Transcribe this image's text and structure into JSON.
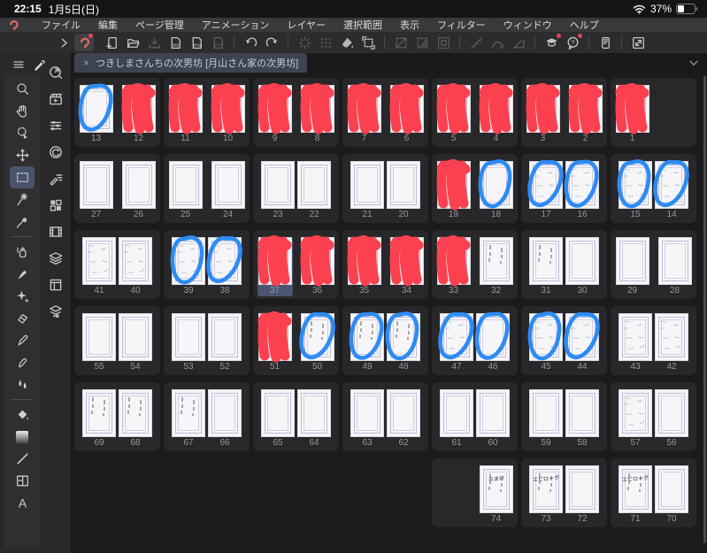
{
  "status_bar": {
    "time": "22:15",
    "date": "1月5日(日)",
    "battery_percent": "37%",
    "icons": [
      "wifi-icon",
      "battery-icon"
    ]
  },
  "menu_bar": {
    "logo_icon": "clip-studio-logo-icon",
    "items": [
      "ファイル",
      "編集",
      "ページ管理",
      "アニメーション",
      "レイヤー",
      "選択範囲",
      "表示",
      "フィルター",
      "ウィンドウ",
      "ヘルプ"
    ]
  },
  "toolbar": {
    "items": [
      {
        "icon": "collapse-chevron-icon"
      },
      {
        "icon": "app-logo-icon",
        "boxed": true,
        "badge": true
      },
      {
        "icon": "new-page-icon"
      },
      {
        "icon": "folder-open-icon"
      },
      {
        "icon": "export-down-icon",
        "dim": true
      },
      {
        "icon": "file-jpg-icon",
        "label": "jpg"
      },
      {
        "icon": "file-png-icon",
        "label": "png"
      },
      {
        "icon": "file-psd-icon",
        "label": "psd",
        "dim": true
      },
      {
        "divider": true
      },
      {
        "icon": "undo-icon"
      },
      {
        "icon": "redo-icon"
      },
      {
        "divider": true
      },
      {
        "icon": "processing-icon",
        "dim": true
      },
      {
        "icon": "screentone-icon",
        "dim": true
      },
      {
        "icon": "material-bucket-icon"
      },
      {
        "icon": "canvas-crop-icon"
      },
      {
        "divider": true
      },
      {
        "icon": "deselect-icon",
        "dim": true
      },
      {
        "icon": "invert-selection-icon",
        "dim": true
      },
      {
        "icon": "selection-border-icon",
        "dim": true
      },
      {
        "divider": true
      },
      {
        "icon": "snap-ruler-icon",
        "dim": true
      },
      {
        "icon": "snap-curve-icon",
        "dim": true
      },
      {
        "icon": "snap-angle-icon",
        "dim": true
      },
      {
        "divider": true
      },
      {
        "icon": "tutorial-cap-icon",
        "badge": true
      },
      {
        "icon": "help-bubble-icon",
        "badge": true
      },
      {
        "divider": true
      },
      {
        "icon": "companion-device-icon"
      },
      {
        "divider": true
      },
      {
        "icon": "window-resize-icon"
      }
    ]
  },
  "tab_bar": {
    "close_glyph": "×",
    "title": "つきしまさんちの次男坊 [月山さん家の次男坊]",
    "chevron_icon": "tab-list-chevron-down-icon"
  },
  "sidebar": {
    "header_icons": [
      "palette-menu-icon",
      "edit-pen-icon"
    ],
    "tools": [
      {
        "icon": "zoom-icon"
      },
      {
        "icon": "hand-icon"
      },
      {
        "icon": "operate-icon"
      },
      {
        "icon": "move-icon"
      },
      {
        "icon": "select-rect-icon",
        "selected": true
      },
      {
        "icon": "wand-icon"
      },
      {
        "icon": "eyedropper-icon"
      },
      {
        "divider": true
      },
      {
        "icon": "airbrush-icon"
      },
      {
        "icon": "pen-icon"
      },
      {
        "icon": "decoration-icon"
      },
      {
        "icon": "eraser-icon"
      },
      {
        "icon": "marker-icon"
      },
      {
        "icon": "blend-icon"
      },
      {
        "icon": "water-icon"
      },
      {
        "divider": true
      },
      {
        "icon": "fill-bucket-icon"
      },
      {
        "icon": "gradient-icon"
      },
      {
        "icon": "line-icon"
      },
      {
        "icon": "frame-border-icon"
      },
      {
        "icon": "text-icon"
      }
    ],
    "panel_icons": [
      "quick-access-icon",
      "clapper-icon",
      "correction-icon",
      "timeline-icon",
      "story-editor-icon",
      "material-grid-icon",
      "filmstrip-icon",
      "layers-icon",
      "page-manager-icon",
      "layer-property-icon"
    ]
  },
  "page_grid": {
    "rows": [
      {
        "panels": [
          {
            "j": false,
            "pages": [
              {
                "n": "13",
                "mark": "blue",
                "c": "blank"
              },
              {
                "n": "12",
                "mark": "red",
                "c": "blank"
              }
            ]
          },
          {
            "j": false,
            "pages": [
              {
                "n": "11",
                "mark": "red",
                "c": "blank"
              },
              {
                "n": "10",
                "mark": "red",
                "c": "blank"
              }
            ]
          },
          {
            "j": false,
            "pages": [
              {
                "n": "9",
                "mark": "red",
                "c": "blank"
              },
              {
                "n": "8",
                "mark": "red",
                "c": "blank"
              }
            ]
          },
          {
            "j": false,
            "pages": [
              {
                "n": "7",
                "mark": "red",
                "c": "blank"
              },
              {
                "n": "6",
                "mark": "red",
                "c": "blank"
              }
            ]
          },
          {
            "j": false,
            "pages": [
              {
                "n": "5",
                "mark": "red",
                "c": "blank"
              },
              {
                "n": "4",
                "mark": "red",
                "c": "blank"
              }
            ]
          },
          {
            "j": false,
            "pages": [
              {
                "n": "3",
                "mark": "red",
                "c": "blank"
              },
              {
                "n": "2",
                "mark": "red",
                "c": "blank"
              }
            ]
          },
          {
            "single": "left",
            "pages": [
              {
                "n": "1",
                "mark": "red",
                "c": "blank"
              }
            ]
          }
        ]
      },
      {
        "panels": [
          {
            "j": false,
            "pages": [
              {
                "n": "27",
                "c": "blank"
              },
              {
                "n": "26",
                "c": "blank"
              }
            ]
          },
          {
            "j": false,
            "pages": [
              {
                "n": "25",
                "c": "blank"
              },
              {
                "n": "24",
                "c": "blank"
              }
            ]
          },
          {
            "j": true,
            "pages": [
              {
                "n": "23",
                "c": "blank"
              },
              {
                "n": "22",
                "c": "blank"
              }
            ]
          },
          {
            "j": true,
            "pages": [
              {
                "n": "21",
                "c": "blank"
              },
              {
                "n": "20",
                "c": "blank"
              }
            ]
          },
          {
            "j": false,
            "pages": [
              {
                "n": "19",
                "mark": "red",
                "c": "blank"
              },
              {
                "n": "18",
                "mark": "blue",
                "c": "blank"
              }
            ]
          },
          {
            "j": true,
            "pages": [
              {
                "n": "17",
                "mark": "blue",
                "c": "sketch"
              },
              {
                "n": "16",
                "mark": "blue",
                "c": "sketch"
              }
            ]
          },
          {
            "j": true,
            "pages": [
              {
                "n": "15",
                "mark": "blue",
                "c": "sketch"
              },
              {
                "n": "14",
                "mark": "blue",
                "c": "sketch"
              }
            ]
          }
        ]
      },
      {
        "panels": [
          {
            "j": true,
            "pages": [
              {
                "n": "41",
                "c": "sketch"
              },
              {
                "n": "40",
                "c": "sketch"
              }
            ]
          },
          {
            "j": true,
            "pages": [
              {
                "n": "39",
                "mark": "blue",
                "c": "sketch"
              },
              {
                "n": "38",
                "mark": "blue",
                "c": "sketch"
              }
            ]
          },
          {
            "j": false,
            "pages": [
              {
                "n": "37",
                "mark": "red",
                "c": "blank",
                "selected": true
              },
              {
                "n": "36",
                "mark": "red",
                "c": "blank"
              }
            ]
          },
          {
            "j": false,
            "pages": [
              {
                "n": "35",
                "mark": "red",
                "c": "blank"
              },
              {
                "n": "34",
                "mark": "red",
                "c": "blank"
              }
            ]
          },
          {
            "j": false,
            "pages": [
              {
                "n": "33",
                "mark": "red",
                "c": "blank"
              },
              {
                "n": "32",
                "c": "text"
              }
            ]
          },
          {
            "j": true,
            "pages": [
              {
                "n": "31",
                "c": "text"
              },
              {
                "n": "30",
                "c": "blank"
              }
            ]
          },
          {
            "j": false,
            "pages": [
              {
                "n": "29",
                "c": "blank"
              },
              {
                "n": "28",
                "c": "blank"
              }
            ]
          }
        ]
      },
      {
        "panels": [
          {
            "j": true,
            "pages": [
              {
                "n": "55",
                "c": "blank"
              },
              {
                "n": "54",
                "c": "blank"
              }
            ]
          },
          {
            "j": true,
            "pages": [
              {
                "n": "53",
                "c": "blank"
              },
              {
                "n": "52",
                "c": "blank"
              }
            ]
          },
          {
            "j": false,
            "pages": [
              {
                "n": "51",
                "mark": "red",
                "c": "blank"
              },
              {
                "n": "50",
                "mark": "blue",
                "c": "text"
              }
            ]
          },
          {
            "j": true,
            "pages": [
              {
                "n": "49",
                "mark": "blue",
                "c": "text"
              },
              {
                "n": "48",
                "mark": "blue",
                "c": "text"
              }
            ]
          },
          {
            "j": true,
            "pages": [
              {
                "n": "47",
                "mark": "blue",
                "c": "sketch"
              },
              {
                "n": "46",
                "mark": "blue",
                "c": "blank"
              }
            ]
          },
          {
            "j": true,
            "pages": [
              {
                "n": "45",
                "mark": "blue",
                "c": "sketch"
              },
              {
                "n": "44",
                "mark": "blue",
                "c": "sketch"
              }
            ]
          },
          {
            "j": true,
            "pages": [
              {
                "n": "43",
                "c": "sketch"
              },
              {
                "n": "42",
                "c": "sketch"
              }
            ]
          }
        ]
      },
      {
        "panels": [
          {
            "j": true,
            "pages": [
              {
                "n": "69",
                "c": "text"
              },
              {
                "n": "68",
                "c": "text"
              }
            ]
          },
          {
            "j": true,
            "pages": [
              {
                "n": "67",
                "c": "text"
              },
              {
                "n": "66",
                "c": "blank"
              }
            ]
          },
          {
            "j": true,
            "pages": [
              {
                "n": "65",
                "c": "blank"
              },
              {
                "n": "64",
                "c": "blank"
              }
            ]
          },
          {
            "j": true,
            "pages": [
              {
                "n": "63",
                "c": "blank"
              },
              {
                "n": "62",
                "c": "blank"
              }
            ]
          },
          {
            "j": true,
            "pages": [
              {
                "n": "61",
                "c": "blank"
              },
              {
                "n": "60",
                "c": "blank"
              }
            ]
          },
          {
            "j": true,
            "pages": [
              {
                "n": "59",
                "c": "blank"
              },
              {
                "n": "58",
                "c": "blank"
              }
            ]
          },
          {
            "j": true,
            "pages": [
              {
                "n": "57",
                "c": "sketch"
              },
              {
                "n": "56",
                "c": "blank"
              }
            ]
          }
        ]
      },
      {
        "align": "right",
        "panels": [
          {
            "single": "right",
            "pages": [
              {
                "n": "74",
                "c": "text",
                "label": "おまけ"
              }
            ]
          },
          {
            "j": true,
            "pages": [
              {
                "n": "73",
                "c": "text",
                "label": "エピローグ"
              },
              {
                "n": "72",
                "c": "blank"
              }
            ]
          },
          {
            "j": true,
            "pages": [
              {
                "n": "71",
                "c": "text",
                "label": "エピローグ"
              },
              {
                "n": "70",
                "c": "blank"
              }
            ]
          }
        ]
      }
    ]
  },
  "colors": {
    "red_annotation": "#fb4150",
    "blue_annotation": "#2e8bf3",
    "selected_slot": "#4a5670",
    "tab_bg": "#3d4450",
    "logo_accent": "#e0695f"
  }
}
